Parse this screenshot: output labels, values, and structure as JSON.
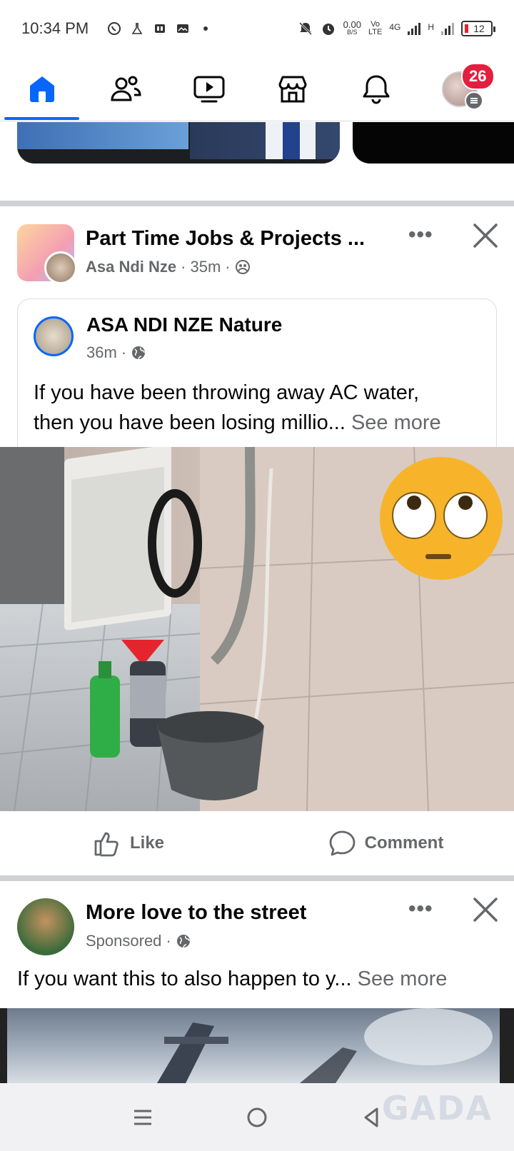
{
  "status_bar": {
    "time": "10:34 PM",
    "net_speed_value": "0.00",
    "net_speed_unit": "B/S",
    "volte_top": "Vo",
    "volte_bottom": "LTE",
    "net_type": "4G",
    "net_type2": "H",
    "battery": "12"
  },
  "top_nav": {
    "notification_count": "26",
    "items": [
      "home",
      "friends",
      "video",
      "marketplace",
      "notifications",
      "menu"
    ]
  },
  "post1": {
    "group_name": "Part Time Jobs & Projects ...",
    "author": "Asa Ndi Nze",
    "time": "35m",
    "more": "•••",
    "shared": {
      "page_name": "ASA NDI NZE Nature",
      "time": "36m",
      "text_line1": "If you have been throwing away AC water,",
      "text_line2": "then you have been losing millio...",
      "see_more": "See more"
    },
    "like_label": "Like",
    "comment_label": "Comment"
  },
  "post2": {
    "title": "More love to the street",
    "meta": "Sponsored",
    "more": "•••",
    "text": "If you want this to also happen to y...",
    "see_more": "See more"
  },
  "watermark": "GADA",
  "colors": {
    "accent": "#0866ff",
    "badge": "#e41e3f",
    "secondary_text": "#65676b"
  }
}
